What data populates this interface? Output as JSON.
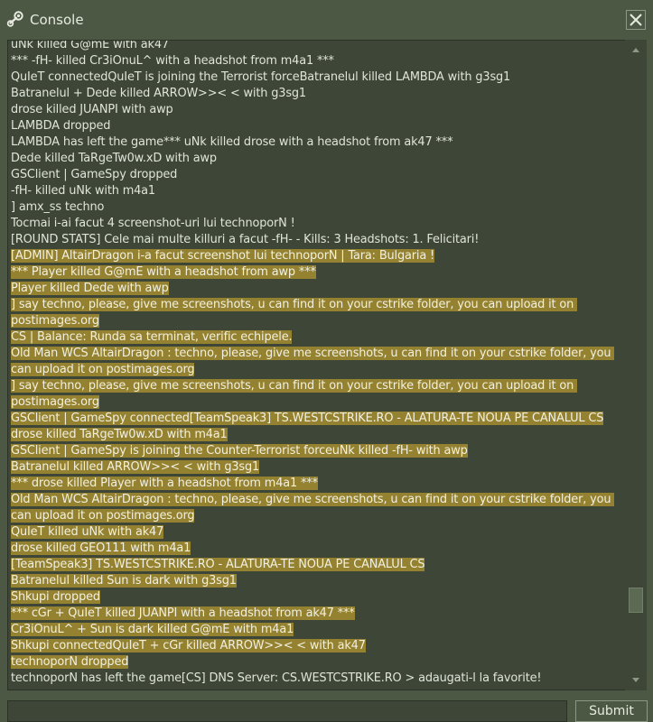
{
  "window": {
    "title": "Console",
    "title_icon": "steam-icon",
    "close_icon": "close-icon"
  },
  "log": [
    {
      "text": "uNk killed G@mE with ak47",
      "selected": false
    },
    {
      "text": "*** -fH- killed Cr3iOnuL^ with a headshot from m4a1 ***",
      "selected": false
    },
    {
      "text": "QuIeT connectedQuIeT is joining the Terrorist forceBatranelul killed LAMBDA with g3sg1",
      "selected": false
    },
    {
      "text": "Batranelul + Dede killed ARROW>>< < with g3sg1",
      "selected": false
    },
    {
      "text": "drose killed JUANPI with awp",
      "selected": false
    },
    {
      "text": "LAMBDA dropped",
      "selected": false
    },
    {
      "text": "LAMBDA has left the game*** uNk killed drose with a headshot from ak47 ***",
      "selected": false
    },
    {
      "text": "Dede killed TaRgeTw0w.xD with awp",
      "selected": false
    },
    {
      "text": "GSClient | GameSpy dropped",
      "selected": false
    },
    {
      "text": "-fH- killed uNk with m4a1",
      "selected": false
    },
    {
      "text": "] amx_ss techno",
      "selected": false
    },
    {
      "text": "Tocmai i-ai facut 4 screenshot-uri lui technoporN !",
      "selected": false
    },
    {
      "text": "[ROUND STATS] Cele mai multe killuri a facut -fH- - Kills: 3 Headshots: 1. Felicitari!",
      "selected": false
    },
    {
      "text": "[ADMIN] AltairDragon i-a facut screenshot lui technoporN | Tara: Bulgaria !",
      "selected": true
    },
    {
      "text": "*** Player killed G@mE with a headshot from awp ***",
      "selected": true
    },
    {
      "text": "Player killed Dede with awp",
      "selected": true
    },
    {
      "text": "] say techno, please, give me screenshots, u can find it on your cstrike folder, you can upload it on postimages.org",
      "selected": true
    },
    {
      "text": "CS | Balance: Runda sa terminat, verific echipele.",
      "selected": true
    },
    {
      "text": "Old Man WCS AltairDragon : techno, please, give me screenshots, u can find it on your cstrike folder, you can upload it on postimages.org",
      "selected": true
    },
    {
      "text": "] say techno, please, give me screenshots, u can find it on your cstrike folder, you can upload it on postimages.org",
      "selected": true
    },
    {
      "text": "GSClient | GameSpy connected[TeamSpeak3] TS.WESTCSTRIKE.RO - ALATURA-TE NOUA PE CANALUL CS",
      "selected": true
    },
    {
      "text": "drose killed TaRgeTw0w.xD with m4a1",
      "selected": true
    },
    {
      "text": "GSClient | GameSpy is joining the Counter-Terrorist forceuNk killed -fH- with awp",
      "selected": true
    },
    {
      "text": "Batranelul killed ARROW>>< < with g3sg1",
      "selected": true
    },
    {
      "text": "*** drose killed Player with a headshot from m4a1 ***",
      "selected": true
    },
    {
      "text": "Old Man WCS AltairDragon : techno, please, give me screenshots, u can find it on your cstrike folder, you can upload it on postimages.org",
      "selected": true
    },
    {
      "text": "QuIeT killed uNk with ak47",
      "selected": true
    },
    {
      "text": "drose killed GEO111 with m4a1",
      "selected": true
    },
    {
      "text": "[TeamSpeak3] TS.WESTCSTRIKE.RO - ALATURA-TE NOUA PE CANALUL CS",
      "selected": true
    },
    {
      "text": "Batranelul killed Sun is dark with g3sg1",
      "selected": true
    },
    {
      "text": "Shkupi dropped",
      "selected": true
    },
    {
      "text": "*** cGr + QuIeT killed JUANPI with a headshot from ak47 ***",
      "selected": true
    },
    {
      "text": "Cr3iOnuL^ + Sun is dark killed G@mE with m4a1",
      "selected": true
    },
    {
      "text": "Shkupi connectedQuIeT + cGr killed ARROW>>< < with ak47",
      "selected": true
    },
    {
      "text": "technoporN dropped",
      "selected": true
    },
    {
      "text": "technoporN has left the game[CS] DNS Server: CS.WESTCSTRIKE.RO > adaugati-l la favorite!",
      "selected": false
    }
  ],
  "input": {
    "value": "",
    "placeholder": ""
  },
  "submit_label": "Submit",
  "colors": {
    "window_bg": "#4c5844",
    "log_bg": "#3e4637",
    "selection_bg": "#958231"
  }
}
